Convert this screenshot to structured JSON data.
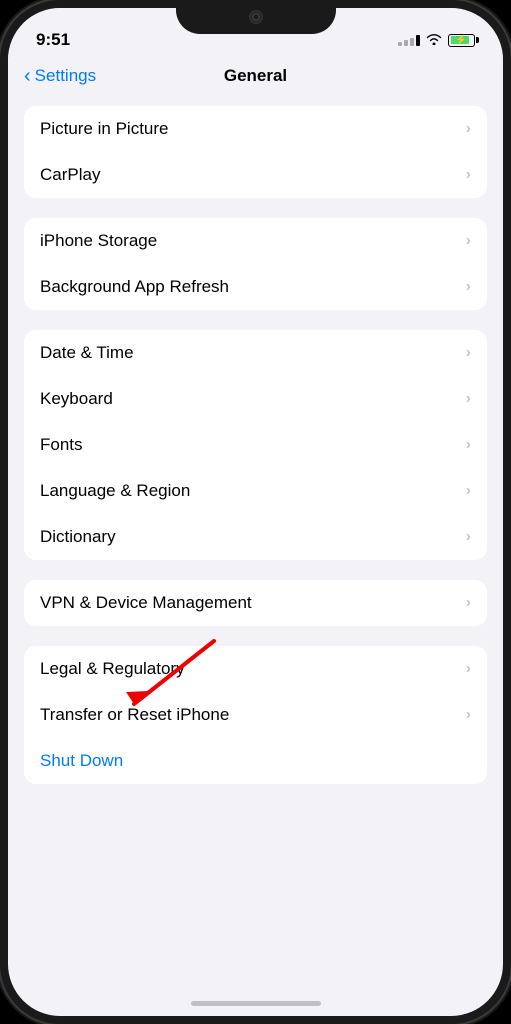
{
  "statusBar": {
    "time": "9:51"
  },
  "navBar": {
    "backLabel": "Settings",
    "title": "General"
  },
  "sections": [
    {
      "id": "section1",
      "cells": [
        {
          "id": "picture-in-picture",
          "label": "Picture in Picture",
          "chevron": true
        },
        {
          "id": "carplay",
          "label": "CarPlay",
          "chevron": true
        }
      ]
    },
    {
      "id": "section2",
      "cells": [
        {
          "id": "iphone-storage",
          "label": "iPhone Storage",
          "chevron": true
        },
        {
          "id": "background-app-refresh",
          "label": "Background App Refresh",
          "chevron": true
        }
      ]
    },
    {
      "id": "section3",
      "cells": [
        {
          "id": "date-time",
          "label": "Date & Time",
          "chevron": true
        },
        {
          "id": "keyboard",
          "label": "Keyboard",
          "chevron": true
        },
        {
          "id": "fonts",
          "label": "Fonts",
          "chevron": true
        },
        {
          "id": "language-region",
          "label": "Language & Region",
          "chevron": true
        },
        {
          "id": "dictionary",
          "label": "Dictionary",
          "chevron": true
        }
      ]
    },
    {
      "id": "section4",
      "cells": [
        {
          "id": "vpn-device-management",
          "label": "VPN & Device Management",
          "chevron": true
        }
      ]
    },
    {
      "id": "section5",
      "cells": [
        {
          "id": "legal-regulatory",
          "label": "Legal & Regulatory",
          "chevron": true
        },
        {
          "id": "transfer-reset",
          "label": "Transfer or Reset iPhone",
          "chevron": true
        },
        {
          "id": "shut-down",
          "label": "Shut Down",
          "chevron": false,
          "blue": true
        }
      ]
    }
  ],
  "icons": {
    "chevron": "›",
    "backChevron": "‹",
    "wifi": "📶"
  }
}
